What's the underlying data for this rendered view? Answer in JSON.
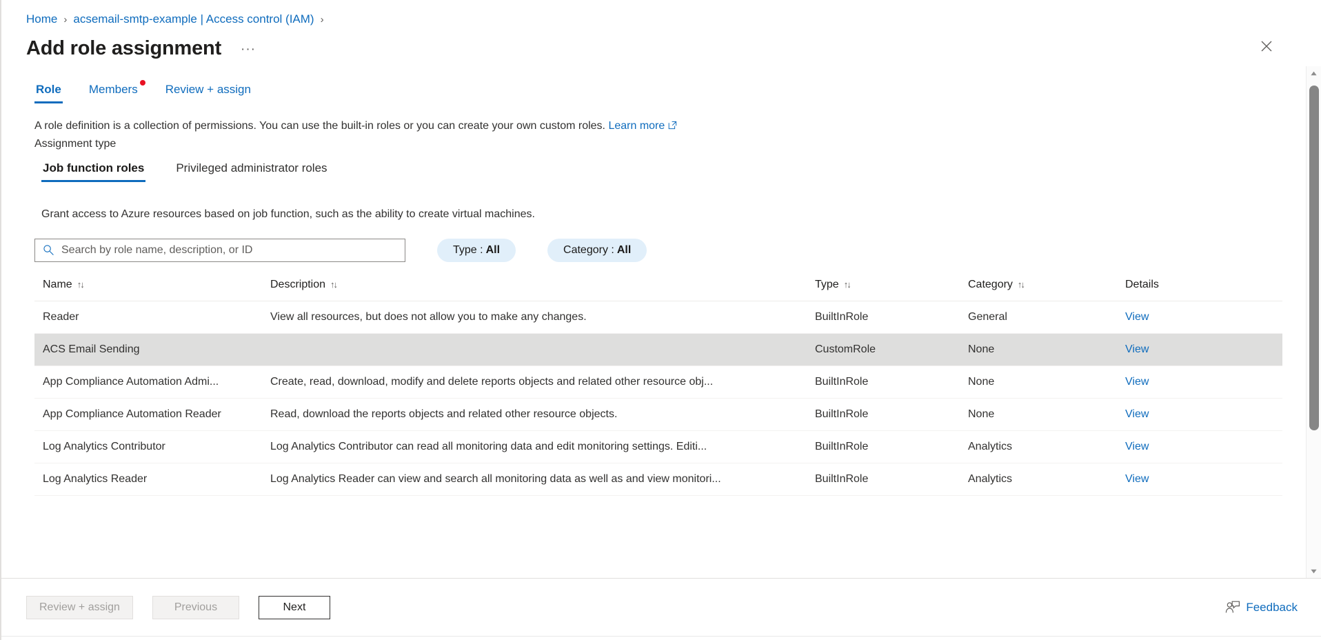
{
  "breadcrumb": {
    "items": [
      {
        "label": "Home"
      },
      {
        "label": "acsemail-smtp-example | Access control (IAM)"
      }
    ],
    "separator": "›"
  },
  "header": {
    "title": "Add role assignment",
    "more_label": "···",
    "close_label": "✕"
  },
  "pivot": {
    "tabs": [
      {
        "label": "Role",
        "active": true,
        "badge": false
      },
      {
        "label": "Members",
        "active": false,
        "badge": true
      },
      {
        "label": "Review + assign",
        "active": false,
        "badge": false
      }
    ]
  },
  "description": {
    "text": "A role definition is a collection of permissions. You can use the built-in roles or you can create your own custom roles.",
    "link_label": "Learn more",
    "assignment_type_label": "Assignment type"
  },
  "subpivot": {
    "tabs": [
      {
        "label": "Job function roles",
        "active": true
      },
      {
        "label": "Privileged administrator roles",
        "active": false
      }
    ]
  },
  "grant_text": "Grant access to Azure resources based on job function, such as the ability to create virtual machines.",
  "toolbar": {
    "search": {
      "placeholder": "Search by role name, description, or ID",
      "value": ""
    },
    "filters": [
      {
        "label": "Type :",
        "value": "All"
      },
      {
        "label": "Category :",
        "value": "All"
      }
    ]
  },
  "table": {
    "columns": [
      {
        "label": "Name",
        "sortable": true
      },
      {
        "label": "Description",
        "sortable": true
      },
      {
        "label": "Type",
        "sortable": true
      },
      {
        "label": "Category",
        "sortable": true
      },
      {
        "label": "Details",
        "sortable": false
      }
    ],
    "sort_glyph": "↑↓",
    "details_link_label": "View",
    "rows": [
      {
        "name": "Reader",
        "description": "View all resources, but does not allow you to make any changes.",
        "type": "BuiltInRole",
        "category": "General",
        "details": "View",
        "selected": false
      },
      {
        "name": "ACS Email Sending",
        "description": "",
        "type": "CustomRole",
        "category": "None",
        "details": "View",
        "selected": true
      },
      {
        "name": "App Compliance Automation Admi...",
        "description": "Create, read, download, modify and delete reports objects and related other resource obj...",
        "type": "BuiltInRole",
        "category": "None",
        "details": "View",
        "selected": false
      },
      {
        "name": "App Compliance Automation Reader",
        "description": "Read, download the reports objects and related other resource objects.",
        "type": "BuiltInRole",
        "category": "None",
        "details": "View",
        "selected": false
      },
      {
        "name": "Log Analytics Contributor",
        "description": "Log Analytics Contributor can read all monitoring data and edit monitoring settings. Editi...",
        "type": "BuiltInRole",
        "category": "Analytics",
        "details": "View",
        "selected": false
      },
      {
        "name": "Log Analytics Reader",
        "description": "Log Analytics Reader can view and search all monitoring data as well as and view monitori...",
        "type": "BuiltInRole",
        "category": "Analytics",
        "details": "View",
        "selected": false
      }
    ]
  },
  "footer": {
    "review_assign_label": "Review + assign",
    "previous_label": "Previous",
    "next_label": "Next",
    "feedback_label": "Feedback"
  },
  "colors": {
    "accent": "#0f6cbd",
    "badge": "#e81123",
    "selected_row": "#dededd",
    "pill_bg": "#e1effa"
  }
}
